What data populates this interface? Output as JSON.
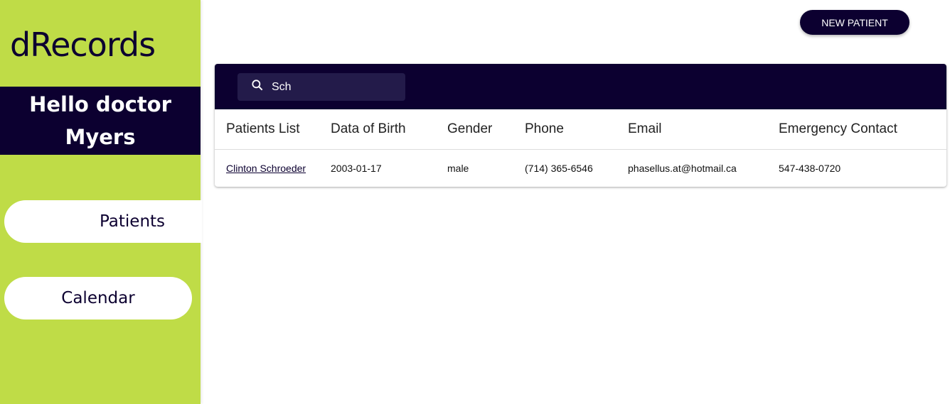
{
  "app": {
    "logo": "dRecords",
    "greeting": "Hello doctor Myers"
  },
  "sidebar": {
    "items": [
      {
        "label": "Patients",
        "active": true
      },
      {
        "label": "Calendar",
        "active": false
      }
    ]
  },
  "toolbar": {
    "new_patient_label": "NEW PATIENT"
  },
  "search": {
    "value": "Sch",
    "icon": "search-icon"
  },
  "table": {
    "columns": [
      "Patients List",
      "Data of Birth",
      "Gender",
      "Phone",
      "Email",
      "Emergency Contact"
    ],
    "rows": [
      {
        "name": "Clinton Schroeder",
        "dob": "2003-01-17",
        "gender": "male",
        "phone": "(714) 365-6546",
        "email": "phasellus.at@hotmail.ca",
        "emergency": "547-438-0720"
      }
    ]
  },
  "colors": {
    "sidebar": "#bfdc47",
    "primary": "#0c0030"
  }
}
